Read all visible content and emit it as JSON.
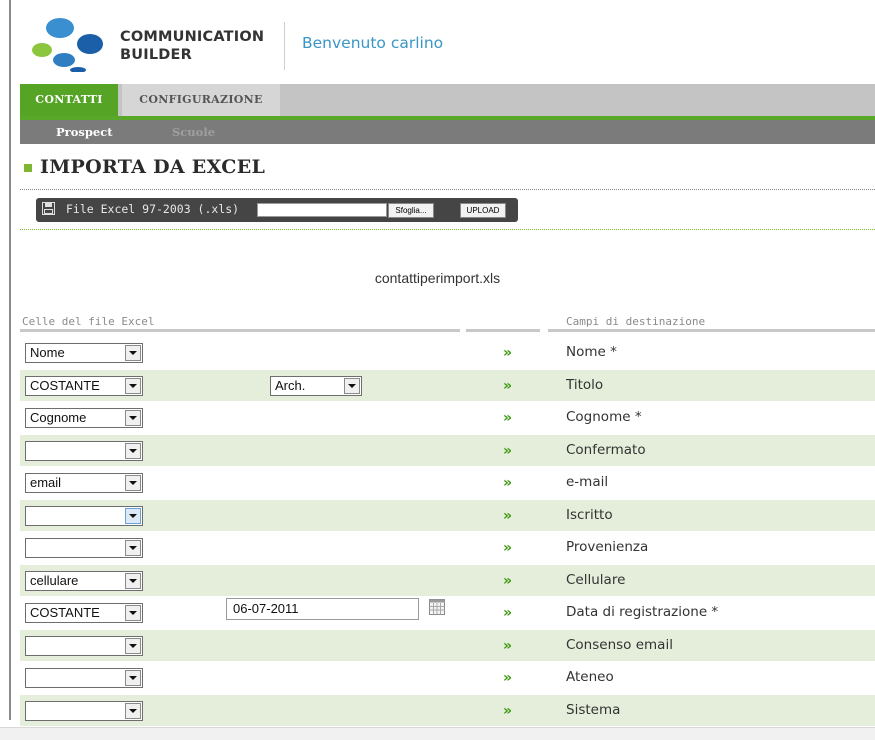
{
  "header": {
    "brand_line1": "COMMUNICATION",
    "brand_line2": "BUILDER",
    "welcome": "Benvenuto carlino",
    "logo_colors": [
      "#3a8fd0",
      "#1b5fa8",
      "#8cc63f",
      "#2f7ec2"
    ]
  },
  "nav": {
    "tabs": [
      {
        "label": "CONTATTI",
        "active": true
      },
      {
        "label": "CONFIGURAZIONE",
        "active": false
      }
    ],
    "subtabs": [
      {
        "label": "Prospect",
        "active": true
      },
      {
        "label": "Scuole",
        "active": false
      }
    ]
  },
  "page": {
    "title": "IMPORTA DA EXCEL"
  },
  "upload": {
    "label": "File Excel 97-2003 (.xls)",
    "file_value": "",
    "browse_label": "Sfoglia...",
    "upload_label": "UPLOAD",
    "icon": "save-icon"
  },
  "filename": "contattiperimport.xls",
  "columns": {
    "left": "Celle del file Excel",
    "right": "Campi di destinazione"
  },
  "mapping_arrow": "»",
  "rows": [
    {
      "source": "Nome",
      "field": "Nome *"
    },
    {
      "source": "COSTANTE",
      "constant": "Arch.",
      "field": "Titolo"
    },
    {
      "source": "Cognome",
      "field": "Cognome *"
    },
    {
      "source": "",
      "field": "Confermato"
    },
    {
      "source": "email",
      "field": "e-mail"
    },
    {
      "source": "",
      "field": "Iscritto"
    },
    {
      "source": "",
      "field": "Provenienza"
    },
    {
      "source": "cellulare",
      "field": "Cellulare"
    },
    {
      "source": "COSTANTE",
      "date": "06-07-2011",
      "field": "Data di registrazione *"
    },
    {
      "source": "",
      "field": "Consenso email"
    },
    {
      "source": "",
      "field": "Ateneo"
    },
    {
      "source": "",
      "field": "Sistema"
    }
  ],
  "colors": {
    "accent_green": "#55a426",
    "arrow_green": "#3e9a12",
    "row_alt": "#e4eedb",
    "welcome_blue": "#3a96c6"
  }
}
